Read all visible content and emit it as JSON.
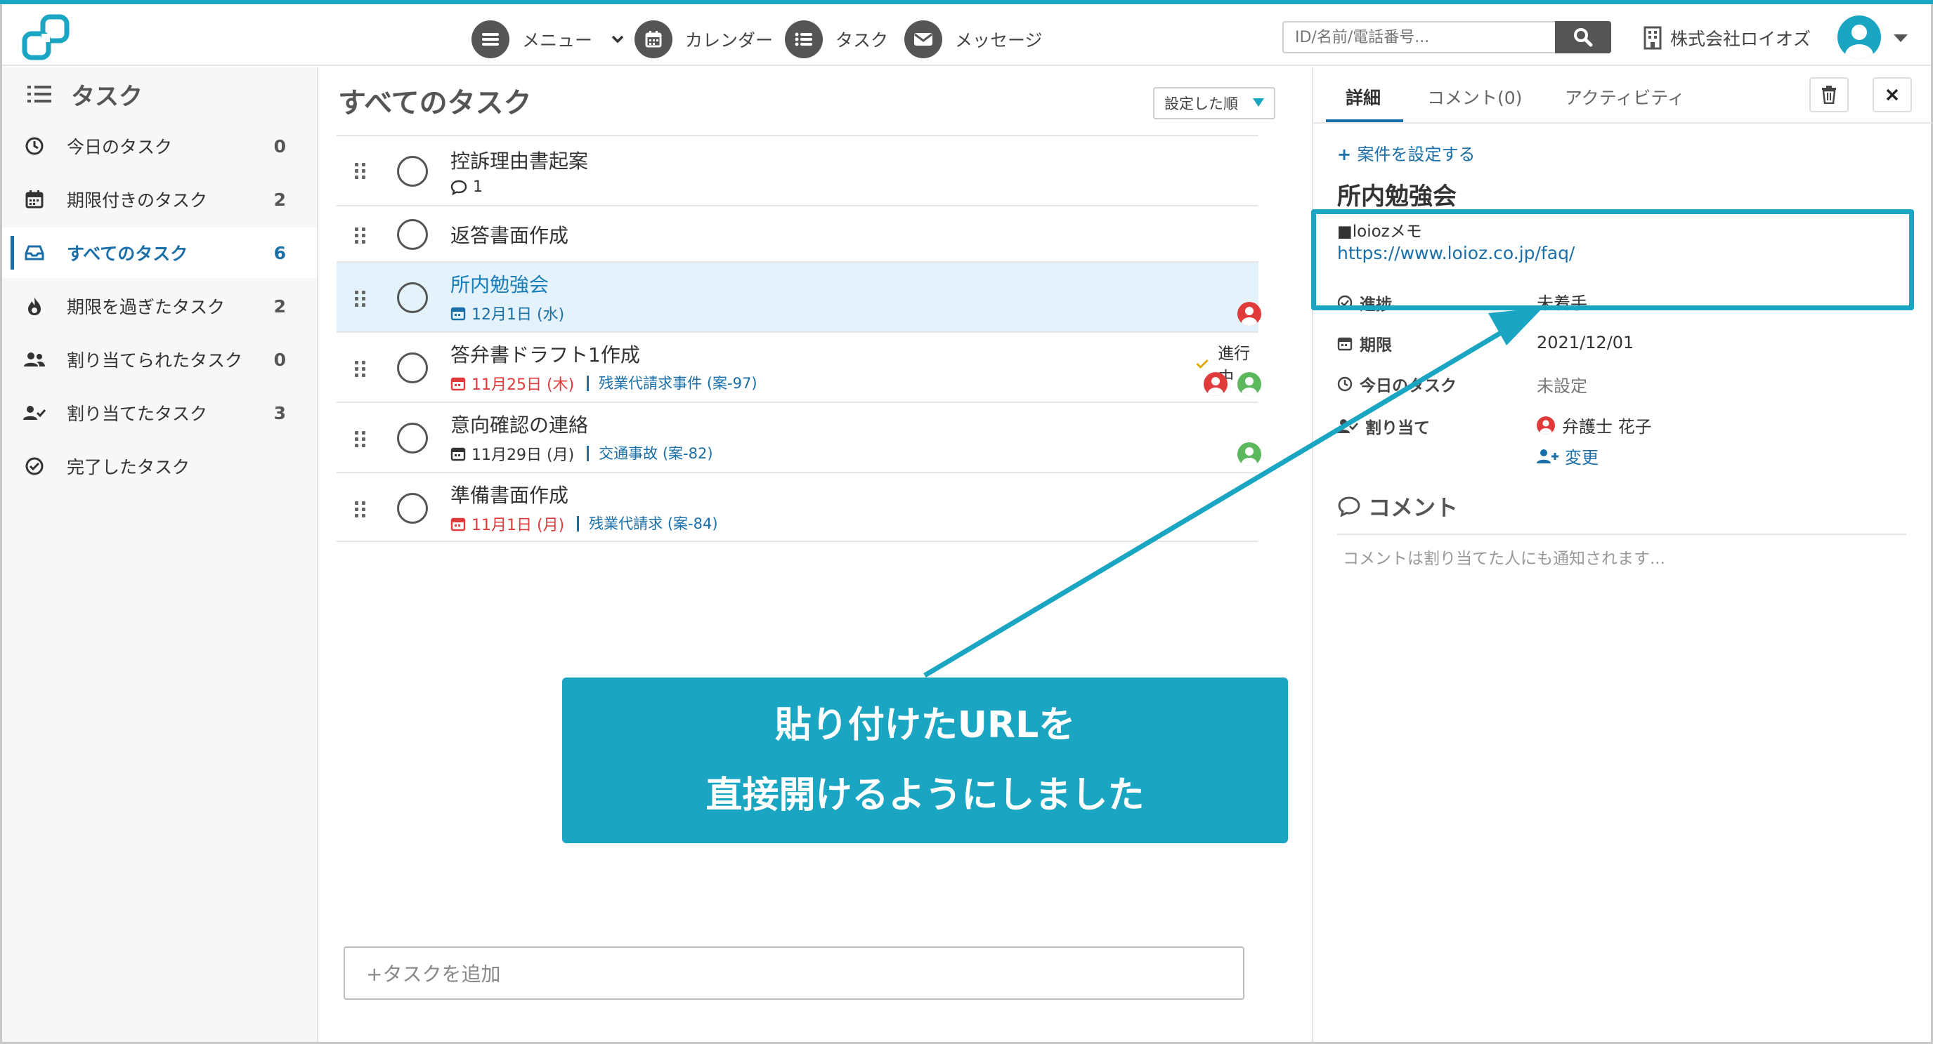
{
  "header": {
    "nav": [
      {
        "label": "メニュー"
      },
      {
        "label": "カレンダー"
      },
      {
        "label": "タスク"
      },
      {
        "label": "メッセージ"
      }
    ],
    "search_placeholder": "ID/名前/電話番号...",
    "company": "株式会社ロイオズ"
  },
  "sidebar": {
    "title": "タスク",
    "items": [
      {
        "label": "今日のタスク",
        "count": "0",
        "icon": "clock-icon"
      },
      {
        "label": "期限付きのタスク",
        "count": "2",
        "icon": "calendar-icon"
      },
      {
        "label": "すべてのタスク",
        "count": "6",
        "icon": "inbox-icon",
        "active": true
      },
      {
        "label": "期限を過ぎたタスク",
        "count": "2",
        "icon": "fire-icon"
      },
      {
        "label": "割り当てられたタスク",
        "count": "0",
        "icon": "users-icon"
      },
      {
        "label": "割り当てたタスク",
        "count": "3",
        "icon": "user-check-icon"
      },
      {
        "label": "完了したタスク",
        "count": "",
        "icon": "check-circle-icon"
      }
    ]
  },
  "list": {
    "title": "すべてのタスク",
    "sort_label": "設定した順",
    "add_placeholder": "+タスクを追加",
    "tasks": [
      {
        "title": "控訴理由書起案",
        "comments": "1"
      },
      {
        "title": "返答書面作成"
      },
      {
        "title": "所内勉強会",
        "date": "12月1日 (水)"
      },
      {
        "title": "答弁書ドラフト1作成",
        "date": "11月25日 (木)",
        "case": "残業代請求事件 (案-97)",
        "status": "進行中"
      },
      {
        "title": "意向確認の連絡",
        "date": "11月29日 (月)",
        "case": "交通事故 (案-82)"
      },
      {
        "title": "準備書面作成",
        "date": "11月1日 (月)",
        "case": "残業代請求 (案-84)"
      }
    ]
  },
  "detail": {
    "tabs": [
      "詳細",
      "コメント(0)",
      "アクティビティ"
    ],
    "set_case": "案件を設定する",
    "title": "所内勉強会",
    "memo_heading": "■loiozメモ",
    "memo_url": "https://www.loioz.co.jp/faq/",
    "fields": {
      "progress_label": "進捗",
      "progress_value": "未着手",
      "due_label": "期限",
      "due_value": "2021/12/01",
      "today_label": "今日のタスク",
      "today_value": "未設定",
      "assign_label": "割り当て",
      "assign_value": "弁護士 花子",
      "change_label": "変更"
    },
    "comment_heading": "コメント",
    "comment_placeholder": "コメントは割り当てた人にも通知されます..."
  },
  "callout": {
    "line1": "貼り付けたURLを",
    "line2": "直接開けるようにしました"
  },
  "colors": {
    "accent": "#1aa5c2",
    "link": "#1a6fa8",
    "overdue": "#e03a3a",
    "assignee_red": "#e03a3a",
    "assignee_green": "#5cb85c"
  }
}
